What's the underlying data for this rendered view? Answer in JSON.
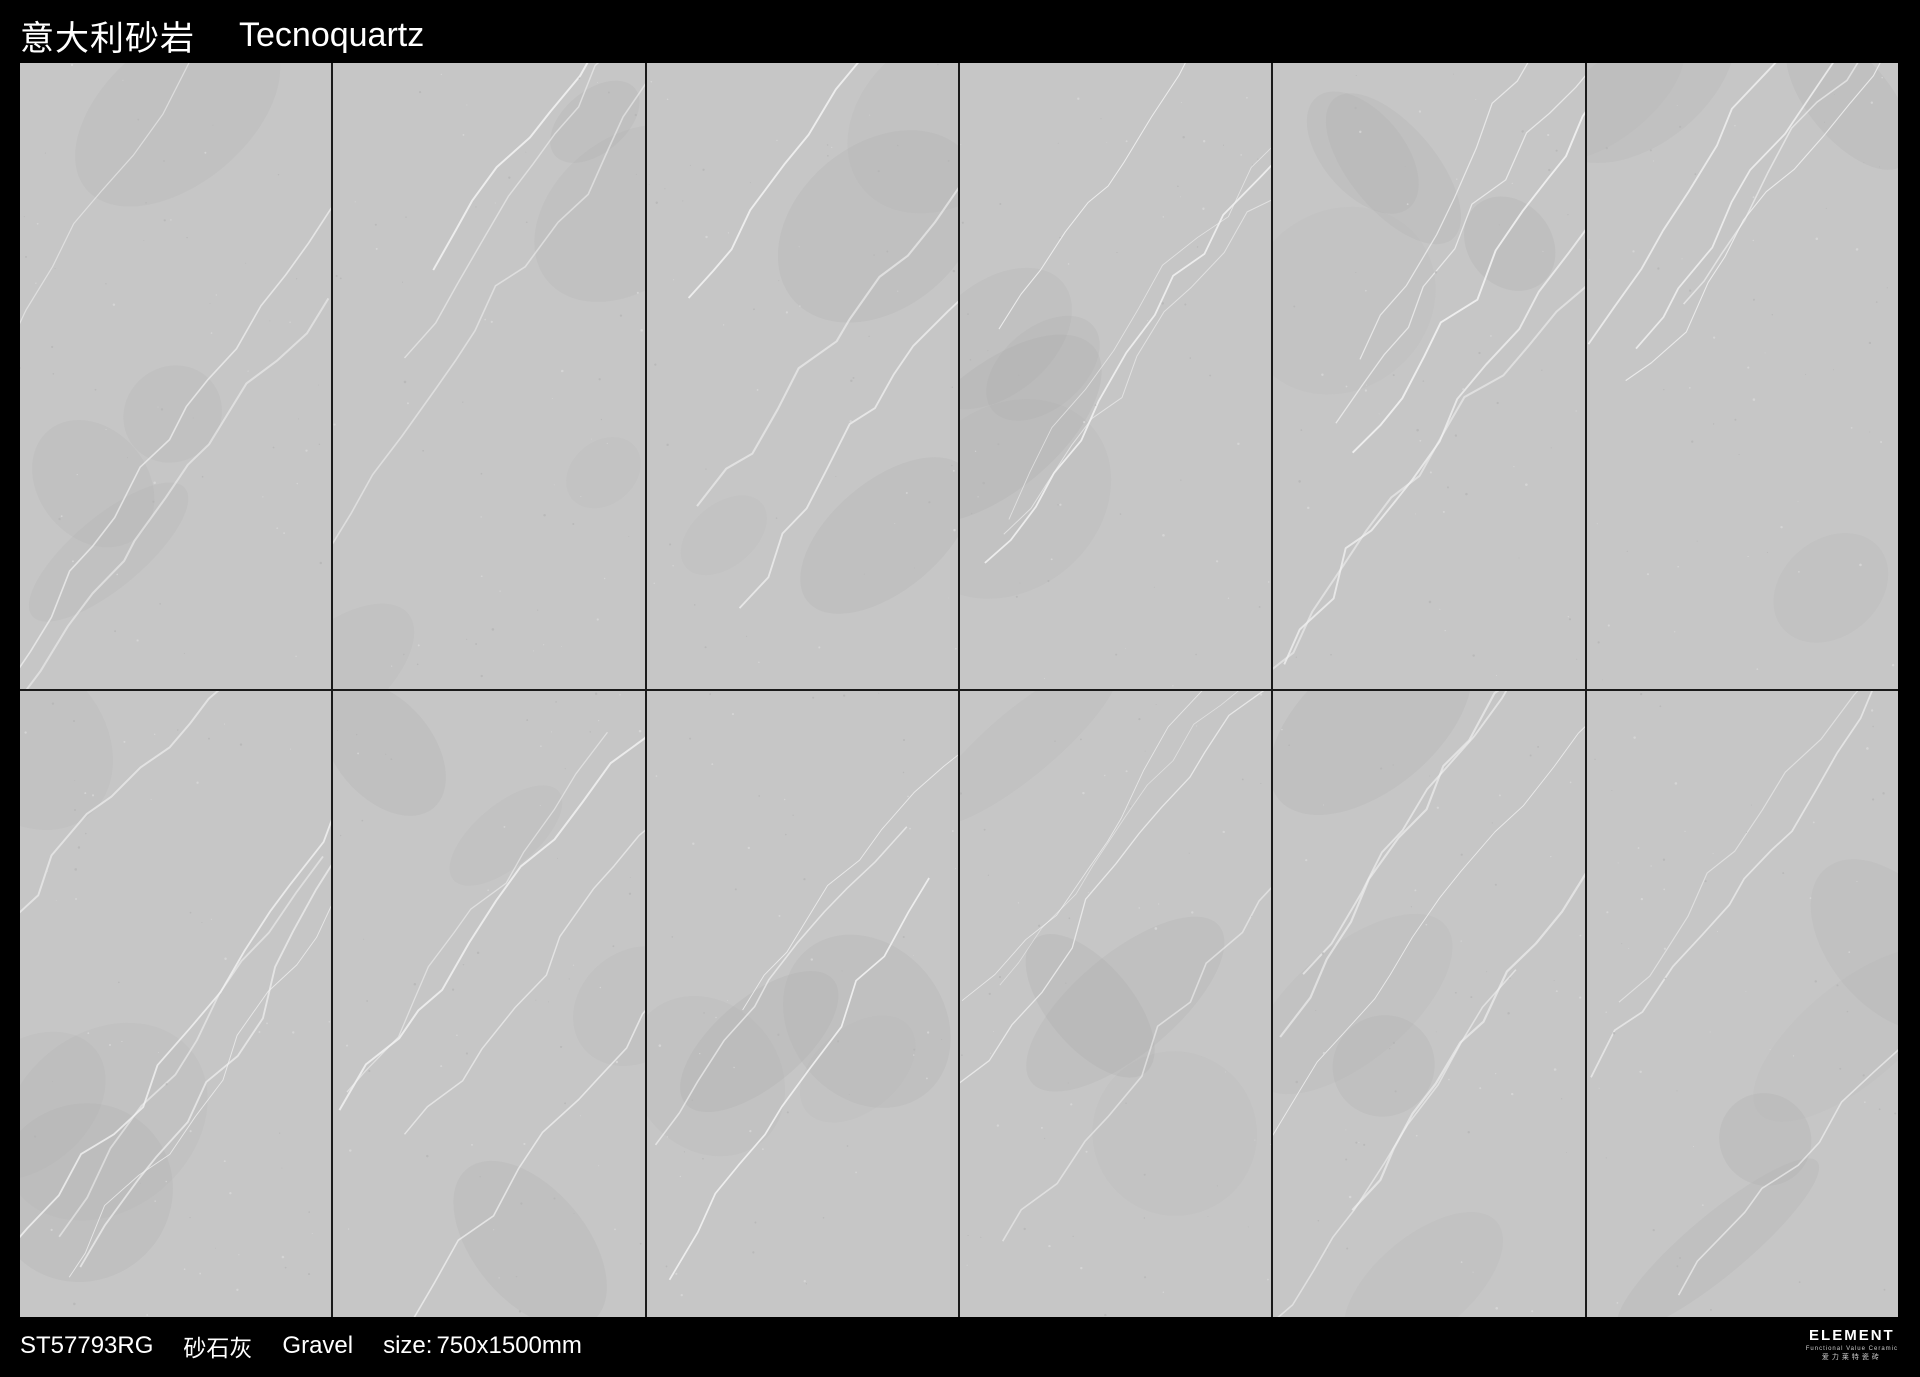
{
  "header": {
    "title_cn": "意大利砂岩",
    "title_en": "Tecnoquartz"
  },
  "tiles": {
    "count": 12,
    "base_color": "#c6c6c6",
    "vein_color": "#f2f2f2",
    "shade_color": "#a9a9a9"
  },
  "footer": {
    "code": "ST57793RG",
    "name_cn": "砂石灰",
    "name_en": "Gravel",
    "size_label": "size",
    "size_sep": ":",
    "size_value": "750x1500mm"
  },
  "logo": {
    "main": "ELEMENT",
    "sub": "Functional Value Ceramic",
    "cn": "爱力莱特瓷砖"
  },
  "colors": {
    "background": "#000000",
    "text": "#ffffff"
  }
}
